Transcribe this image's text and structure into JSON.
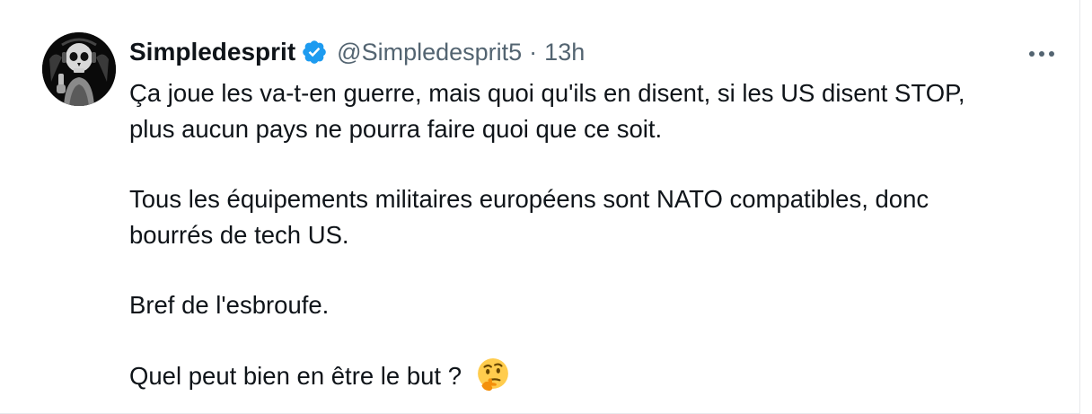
{
  "tweet": {
    "author": {
      "display_name": "Simpledesprit",
      "handle": "@Simpledesprit5",
      "verified": true,
      "avatar": "skull-avatar"
    },
    "separator": "·",
    "time": "13h",
    "more_icon": "ellipsis-icon",
    "paragraphs": [
      {
        "lines": [
          "Ça joue les va-t-en guerre, mais quoi qu'ils en disent, si les US disent STOP,",
          "plus aucun pays ne pourra faire quoi que ce soit."
        ]
      },
      {
        "lines": [
          "Tous les équipements militaires européens sont NATO compatibles, donc",
          "bourrés de tech US."
        ]
      },
      {
        "lines": [
          "Bref de l'esbroufe."
        ]
      },
      {
        "lines": [
          "Quel peut bien en être le but ?"
        ],
        "emoji": "thinking-face-emoji"
      }
    ]
  },
  "colors": {
    "text": "#0f1419",
    "secondary": "#536471",
    "verified_blue": "#1d9bf0",
    "border": "#e7e9ec"
  }
}
